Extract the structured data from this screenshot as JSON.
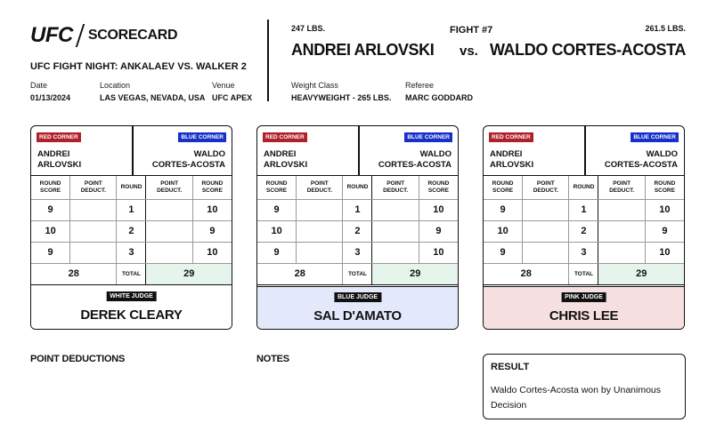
{
  "header": {
    "logo_text": "UFC",
    "scorecard_label": "SCORECARD",
    "event_name": "UFC FIGHT NIGHT: ANKALAEV VS. WALKER 2",
    "date_label": "Date",
    "date_value": "01/13/2024",
    "location_label": "Location",
    "location_value": "LAS VEGAS, NEVADA, USA",
    "venue_label": "Venue",
    "venue_value": "UFC APEX"
  },
  "fight": {
    "number": "FIGHT #7",
    "vs": "vs.",
    "red_weight": "247 LBS.",
    "red_name": "ANDREI ARLOVSKI",
    "blue_weight": "261.5 LBS.",
    "blue_name": "WALDO CORTES-ACOSTA",
    "weight_class_label": "Weight Class",
    "weight_class_value": "HEAVYWEIGHT - 265 LBS.",
    "referee_label": "Referee",
    "referee_value": "MARC GODDARD"
  },
  "card_labels": {
    "red_corner": "RED CORNER",
    "blue_corner": "BLUE CORNER",
    "red_first": "ANDREI",
    "red_last": "ARLOVSKI",
    "blue_first": "WALDO",
    "blue_last": "CORTES-ACOSTA",
    "round_score_1": "ROUND",
    "round_score_2": "SCORE",
    "point_deduct_1": "POINT",
    "point_deduct_2": "DEDUCT.",
    "round": "ROUND",
    "total": "TOTAL"
  },
  "judges": [
    {
      "title": "WHITE JUDGE",
      "name": "DEREK CLEARY",
      "bg": "#ffffff",
      "rounds": [
        {
          "red": "9",
          "red_ded": "",
          "round": "1",
          "blue_ded": "",
          "blue": "10"
        },
        {
          "red": "10",
          "red_ded": "",
          "round": "2",
          "blue_ded": "",
          "blue": "9"
        },
        {
          "red": "9",
          "red_ded": "",
          "round": "3",
          "blue_ded": "",
          "blue": "10"
        }
      ],
      "red_total": "28",
      "blue_total": "29"
    },
    {
      "title": "BLUE JUDGE",
      "name": "SAL D'AMATO",
      "bg": "#e3e9fb",
      "rounds": [
        {
          "red": "9",
          "red_ded": "",
          "round": "1",
          "blue_ded": "",
          "blue": "10"
        },
        {
          "red": "10",
          "red_ded": "",
          "round": "2",
          "blue_ded": "",
          "blue": "9"
        },
        {
          "red": "9",
          "red_ded": "",
          "round": "3",
          "blue_ded": "",
          "blue": "10"
        }
      ],
      "red_total": "28",
      "blue_total": "29"
    },
    {
      "title": "PINK JUDGE",
      "name": "CHRIS LEE",
      "bg": "#f6dfe0",
      "rounds": [
        {
          "red": "9",
          "red_ded": "",
          "round": "1",
          "blue_ded": "",
          "blue": "10"
        },
        {
          "red": "10",
          "red_ded": "",
          "round": "2",
          "blue_ded": "",
          "blue": "9"
        },
        {
          "red": "9",
          "red_ded": "",
          "round": "3",
          "blue_ded": "",
          "blue": "10"
        }
      ],
      "red_total": "28",
      "blue_total": "29"
    }
  ],
  "sections": {
    "point_deductions": "POINT DEDUCTIONS",
    "notes": "NOTES",
    "result_title": "RESULT",
    "result_text": "Waldo Cortes-Acosta won by Unanimous Decision"
  }
}
